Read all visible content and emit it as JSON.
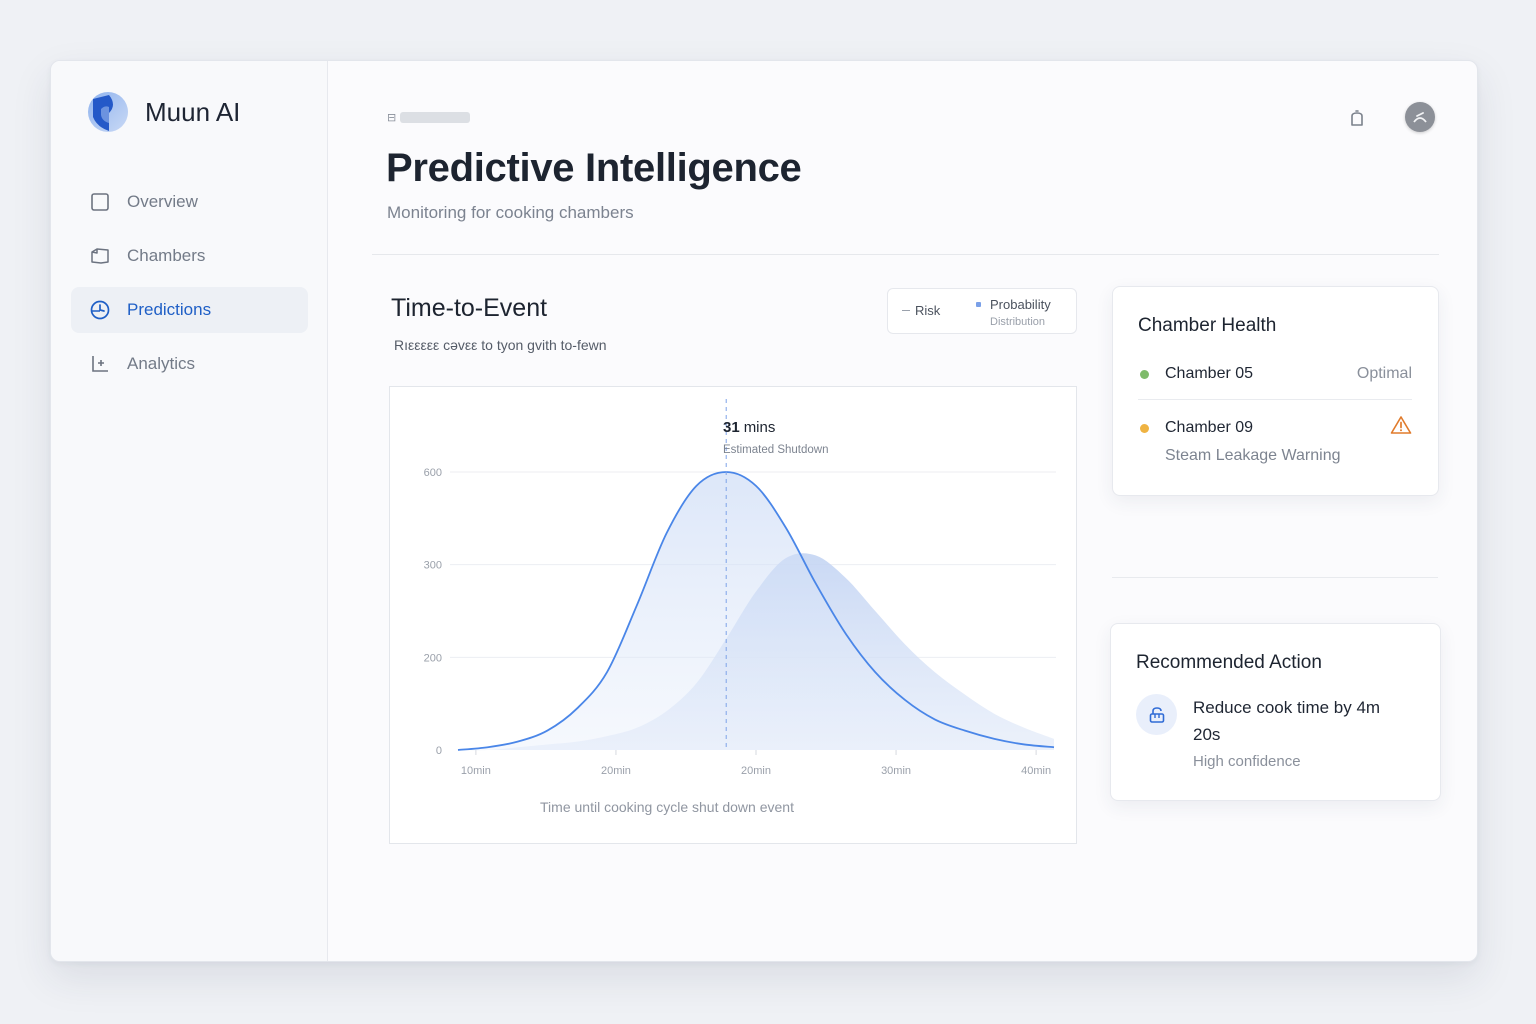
{
  "app": {
    "name": "Muun AI"
  },
  "sidebar": {
    "items": [
      {
        "label": "Overview",
        "icon": "square-icon",
        "active": false
      },
      {
        "label": "Chambers",
        "icon": "chamber-icon",
        "active": false
      },
      {
        "label": "Predictions",
        "icon": "clock-pie-icon",
        "active": true
      },
      {
        "label": "Analytics",
        "icon": "chart-axis-icon",
        "active": false
      }
    ]
  },
  "header": {
    "breadcrumb": "·",
    "title": "Predictive Intelligence",
    "subtitle": "Monitoring for cooking chambers"
  },
  "chart_panel": {
    "title": "Time-to-Event",
    "subtitle": "Rıεεεεε cəvεε to tyon gvith to-fewn",
    "legend": {
      "risk": "Risk",
      "probability": "Probability",
      "distribution": "Distribution"
    },
    "marker": {
      "value": "31",
      "unit": "mins",
      "label": "Estimated Shutdown"
    },
    "caption": "Time until cooking cycle shut down event"
  },
  "chart_data": {
    "type": "area",
    "xlabel": "Time until cooking cycle shut down event",
    "ylabel": "",
    "x_tick_labels": [
      "10min",
      "20min",
      "20min",
      "30min",
      "40min"
    ],
    "y_tick_labels": [
      "0",
      "200",
      "300",
      "600"
    ],
    "series": [
      {
        "name": "Risk",
        "x": [
          0,
          0.05,
          0.1,
          0.15,
          0.2,
          0.25,
          0.3,
          0.35,
          0.4,
          0.45,
          0.5,
          0.55,
          0.6,
          0.65,
          0.7,
          0.75,
          0.8,
          0.85,
          0.9,
          0.95,
          1.0
        ],
        "values": [
          0,
          1,
          3,
          7,
          15,
          28,
          52,
          78,
          95,
          100,
          95,
          80,
          60,
          42,
          28,
          18,
          11,
          7,
          4,
          2,
          1
        ]
      },
      {
        "name": "Probability Distribution",
        "x": [
          0,
          0.05,
          0.1,
          0.15,
          0.2,
          0.25,
          0.3,
          0.35,
          0.4,
          0.45,
          0.5,
          0.55,
          0.6,
          0.65,
          0.7,
          0.75,
          0.8,
          0.85,
          0.9,
          0.95,
          1.0
        ],
        "values": [
          0,
          0,
          1,
          2,
          3,
          5,
          8,
          14,
          24,
          40,
          57,
          69,
          70,
          62,
          50,
          38,
          28,
          20,
          13,
          8,
          4
        ]
      }
    ],
    "marker_x": 0.45,
    "grid": true
  },
  "health": {
    "title": "Chamber Health",
    "rows": [
      {
        "name": "Chamber 05",
        "status": "Optimal",
        "color": "#7fbb6b"
      },
      {
        "name": "Chamber 09",
        "detail": "Steam Leakage Warning",
        "color": "#efb342",
        "icon": "warning-icon"
      }
    ]
  },
  "action": {
    "title": "Recommended Action",
    "text": "Reduce cook time by 4m 20s",
    "confidence": "High confidence",
    "icon": "lock-icon"
  },
  "colors": {
    "accent": "#1f5fc6",
    "chart_line": "#4a86e8",
    "chart_fill": "#c9d9f5"
  }
}
